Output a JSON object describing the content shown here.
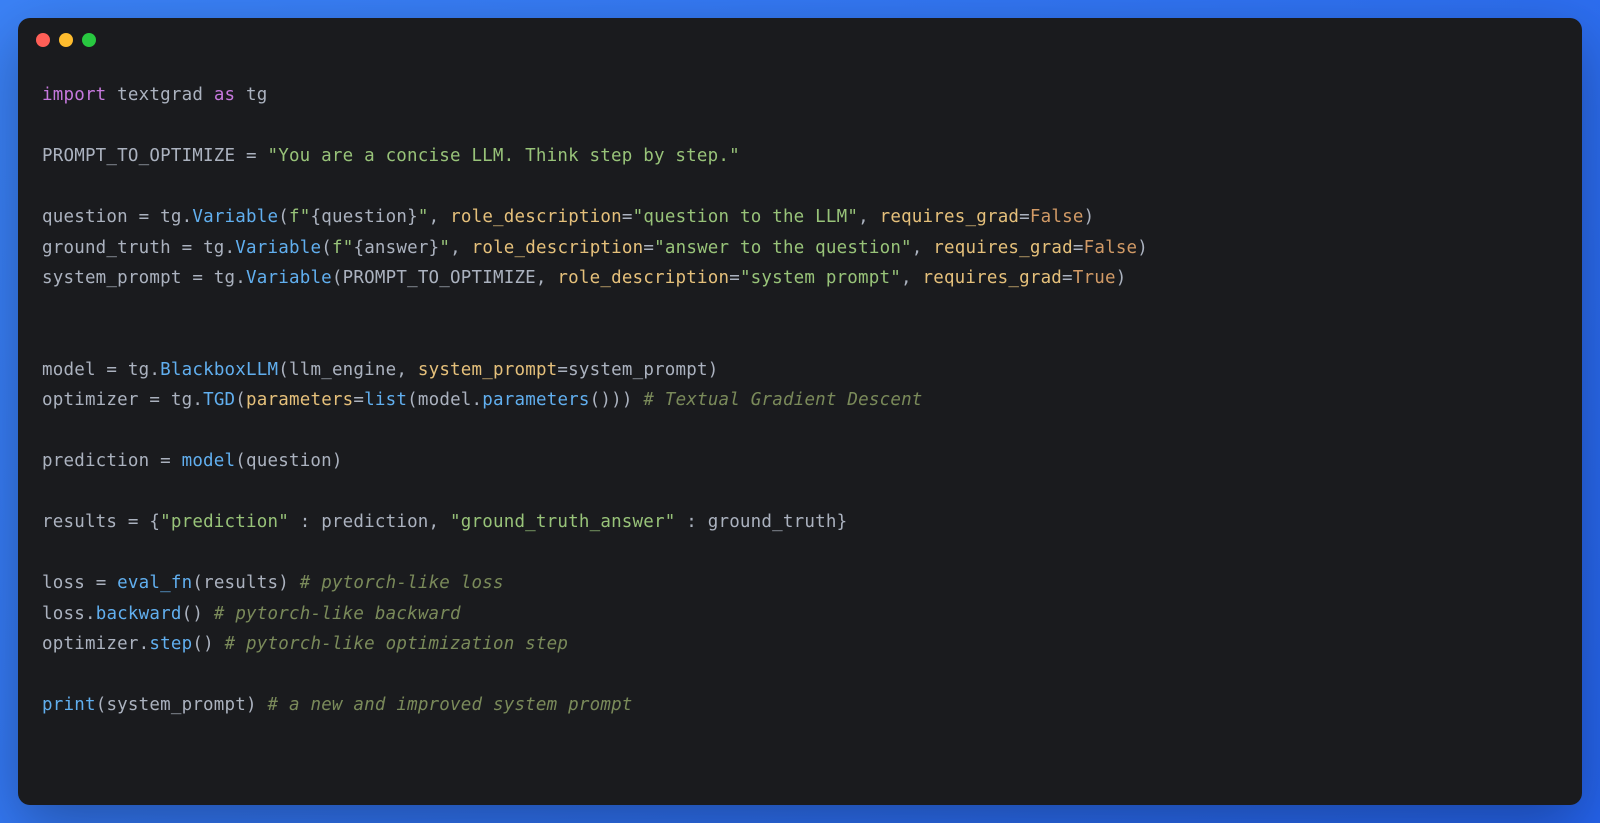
{
  "window": {
    "traffic_lights": [
      "close",
      "minimize",
      "maximize"
    ]
  },
  "code": {
    "line1": {
      "kw_import": "import",
      "module": "textgrad",
      "kw_as": "as",
      "alias": "tg"
    },
    "line3": {
      "var": "PROMPT_TO_OPTIMIZE",
      "eq": " = ",
      "str": "\"You are a concise LLM. Think step by step.\""
    },
    "line5": {
      "var": "question",
      "eq": " = ",
      "obj": "tg",
      "dot": ".",
      "cls": "Variable",
      "open": "(",
      "fstr_prefix": "f",
      "fstr_open": "\"",
      "fstr_brace_open": "{",
      "fstr_var": "question",
      "fstr_brace_close": "}",
      "fstr_close": "\"",
      "comma1": ", ",
      "p1": "role_description",
      "eq1": "=",
      "s1": "\"question to the LLM\"",
      "comma2": ", ",
      "p2": "requires_grad",
      "eq2": "=",
      "b2": "False",
      "close": ")"
    },
    "line6": {
      "var": "ground_truth",
      "eq": " = ",
      "obj": "tg",
      "dot": ".",
      "cls": "Variable",
      "open": "(",
      "fstr_prefix": "f",
      "fstr_open": "\"",
      "fstr_brace_open": "{",
      "fstr_var": "answer",
      "fstr_brace_close": "}",
      "fstr_close": "\"",
      "comma1": ", ",
      "p1": "role_description",
      "eq1": "=",
      "s1": "\"answer to the question\"",
      "comma2": ", ",
      "p2": "requires_grad",
      "eq2": "=",
      "b2": "False",
      "close": ")"
    },
    "line7": {
      "var": "system_prompt",
      "eq": " = ",
      "obj": "tg",
      "dot": ".",
      "cls": "Variable",
      "open": "(",
      "arg1": "PROMPT_TO_OPTIMIZE",
      "comma1": ", ",
      "p1": "role_description",
      "eq1": "=",
      "s1": "\"system prompt\"",
      "comma2": ", ",
      "p2": "requires_grad",
      "eq2": "=",
      "b2": "True",
      "close": ")"
    },
    "line10": {
      "var": "model",
      "eq": " = ",
      "obj": "tg",
      "dot": ".",
      "cls": "BlackboxLLM",
      "open": "(",
      "arg1": "llm_engine",
      "comma1": ", ",
      "p1": "system_prompt",
      "eq1": "=",
      "v1": "system_prompt",
      "close": ")"
    },
    "line11": {
      "var": "optimizer",
      "eq": " = ",
      "obj": "tg",
      "dot": ".",
      "cls": "TGD",
      "open": "(",
      "p1": "parameters",
      "eq1": "=",
      "fn1": "list",
      "open2": "(",
      "arg2": "model",
      "dot2": ".",
      "m2": "parameters",
      "open3": "(",
      "close3": ")",
      "close2": ")",
      "close": ")",
      "sp": " ",
      "comment": "# Textual Gradient Descent"
    },
    "line13": {
      "var": "prediction",
      "eq": " = ",
      "fn": "model",
      "open": "(",
      "arg": "question",
      "close": ")"
    },
    "line15": {
      "var": "results",
      "eq": " = ",
      "open": "{",
      "k1": "\"prediction\"",
      "colon1": " : ",
      "v1": "prediction",
      "comma": ", ",
      "k2": "\"ground_truth_answer\"",
      "colon2": " : ",
      "v2": "ground_truth",
      "close": "}"
    },
    "line17": {
      "var": "loss",
      "eq": " = ",
      "fn": "eval_fn",
      "open": "(",
      "arg": "results",
      "close": ")",
      "sp": " ",
      "comment": "# pytorch-like loss"
    },
    "line18": {
      "obj": "loss",
      "dot": ".",
      "m": "backward",
      "open": "(",
      "close": ")",
      "sp": " ",
      "comment": "# pytorch-like backward"
    },
    "line19": {
      "obj": "optimizer",
      "dot": ".",
      "m": "step",
      "open": "(",
      "close": ")",
      "sp": " ",
      "comment": "# pytorch-like optimization step"
    },
    "line21": {
      "fn": "print",
      "open": "(",
      "arg": "system_prompt",
      "close": ")",
      "sp": " ",
      "comment": "# a new and improved system prompt"
    }
  }
}
